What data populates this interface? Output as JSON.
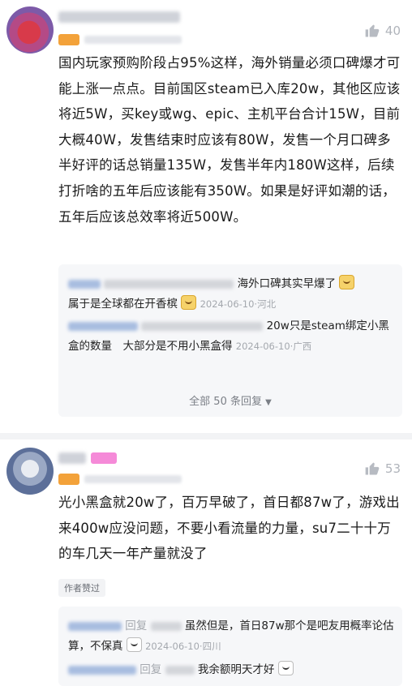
{
  "comments": [
    {
      "likes": "40",
      "text": "国内玩家预购阶段占95%这样，海外销量必须口碑爆才可能上涨一点点。目前国区steam已入库20w，其他区应该将近5W，买key或wg、epic、主机平台合计15W，目前大概40W，发售结束时应该有80W，发售一个月口碑多半好评的话总销量135W，发售半年内180W这样，后续打折啥的五年后应该能有350W。如果是好评如潮的话，五年后应该总效率将近500W。",
      "replies": [
        {
          "text": "海外口碑其实早爆了",
          "text2": "属于是全球都在开香槟",
          "meta": "2024-06-10·河北"
        },
        {
          "text": "20w只是steam绑定小黑盒的数量　大部分是不用小黑盒得",
          "meta": "2024-06-10·广西"
        }
      ],
      "more_label": "全部 50 条回复"
    },
    {
      "likes": "53",
      "text": "光小黑盒就20w了，百万早破了，首日都87w了，游戏出来400w应没问题，不要小看流量的力量，su7二十十万的车几天一年产量就没了",
      "author_liked": "作者赞过",
      "replies": [
        {
          "reply_word": "回复",
          "text": "虽然但是，首日87w那个是吧友用概率论估算，不保真",
          "meta": "2024-06-10·四川"
        },
        {
          "reply_word": "回复",
          "text": "我余额明天才好"
        }
      ]
    }
  ],
  "icons": {
    "like": "thumbs-up-icon",
    "chevron": "chevron-down-icon"
  },
  "colors": {
    "reply_bg": "#f6f7f9",
    "meta": "#a4a8ae",
    "level": "#f3a23a"
  }
}
